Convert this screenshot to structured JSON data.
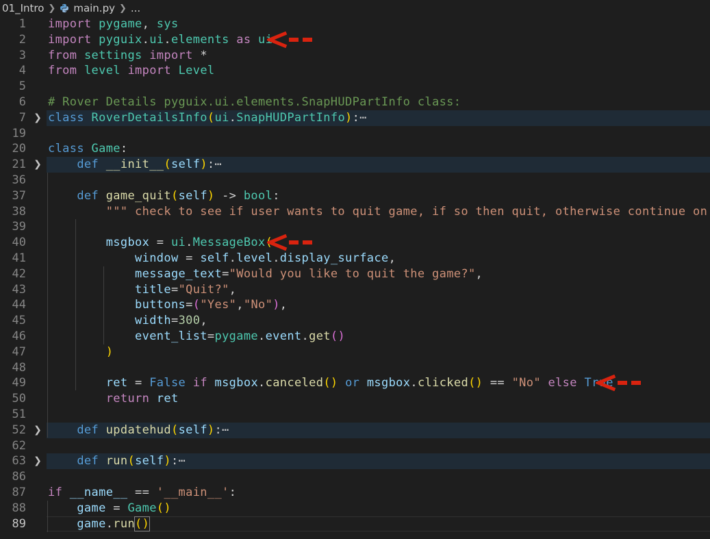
{
  "breadcrumb": {
    "folder": "01_Intro",
    "file": "main.py",
    "more": "..."
  },
  "icons": {
    "separator": "chevron-right-icon",
    "file": "python-file-icon",
    "fold": "chevron-right-icon",
    "annotation": "red-arrow-icon"
  },
  "colors": {
    "background": "#1e1e1e",
    "folded_line": "#1f2b36",
    "arrow": "#d9230f"
  },
  "editor": {
    "lines": [
      {
        "n": "1"
      },
      {
        "n": "2"
      },
      {
        "n": "3"
      },
      {
        "n": "4"
      },
      {
        "n": "5"
      },
      {
        "n": "6"
      },
      {
        "n": "7"
      },
      {
        "n": "19"
      },
      {
        "n": "20"
      },
      {
        "n": "21"
      },
      {
        "n": "36"
      },
      {
        "n": "37"
      },
      {
        "n": "38"
      },
      {
        "n": "39"
      },
      {
        "n": "40"
      },
      {
        "n": "41"
      },
      {
        "n": "42"
      },
      {
        "n": "43"
      },
      {
        "n": "44"
      },
      {
        "n": "45"
      },
      {
        "n": "46"
      },
      {
        "n": "47"
      },
      {
        "n": "48"
      },
      {
        "n": "49"
      },
      {
        "n": "50"
      },
      {
        "n": "51"
      },
      {
        "n": "52"
      },
      {
        "n": "62"
      },
      {
        "n": "63"
      },
      {
        "n": "86"
      },
      {
        "n": "87"
      },
      {
        "n": "88"
      },
      {
        "n": "89"
      }
    ],
    "tokens": {
      "l1": [
        [
          "kw",
          "import"
        ],
        [
          "op",
          " "
        ],
        [
          "cls",
          "pygame"
        ],
        [
          "op",
          ", "
        ],
        [
          "cls",
          "sys"
        ]
      ],
      "l2": [
        [
          "kw",
          "import"
        ],
        [
          "op",
          " "
        ],
        [
          "cls",
          "pyguix"
        ],
        [
          "op",
          "."
        ],
        [
          "cls",
          "ui"
        ],
        [
          "op",
          "."
        ],
        [
          "cls",
          "elements"
        ],
        [
          "op",
          " "
        ],
        [
          "kw",
          "as"
        ],
        [
          "op",
          " "
        ],
        [
          "cls",
          "ui"
        ]
      ],
      "l3": [
        [
          "kw",
          "from"
        ],
        [
          "op",
          " "
        ],
        [
          "cls",
          "settings"
        ],
        [
          "op",
          " "
        ],
        [
          "kw",
          "import"
        ],
        [
          "op",
          " *"
        ]
      ],
      "l4": [
        [
          "kw",
          "from"
        ],
        [
          "op",
          " "
        ],
        [
          "cls",
          "level"
        ],
        [
          "op",
          " "
        ],
        [
          "kw",
          "import"
        ],
        [
          "op",
          " "
        ],
        [
          "cls",
          "Level"
        ]
      ],
      "l5": [],
      "l6": [
        [
          "com",
          "# Rover Details pyguix.ui.elements.SnapHUDPartInfo class:"
        ]
      ],
      "l7": [
        [
          "kb",
          "class"
        ],
        [
          "op",
          " "
        ],
        [
          "cls",
          "RoverDetailsInfo"
        ],
        [
          "p1",
          "("
        ],
        [
          "cls",
          "ui"
        ],
        [
          "op",
          "."
        ],
        [
          "cls",
          "SnapHUDPartInfo"
        ],
        [
          "p1",
          ")"
        ],
        [
          "op",
          ":"
        ],
        [
          "dots",
          "⋯"
        ]
      ],
      "l19": [],
      "l20": [
        [
          "kb",
          "class"
        ],
        [
          "op",
          " "
        ],
        [
          "cls",
          "Game"
        ],
        [
          "op",
          ":"
        ]
      ],
      "l21": [
        [
          "op",
          "    "
        ],
        [
          "kb",
          "def"
        ],
        [
          "op",
          " "
        ],
        [
          "fn",
          "__init__"
        ],
        [
          "p1",
          "("
        ],
        [
          "var",
          "self"
        ],
        [
          "p1",
          ")"
        ],
        [
          "op",
          ":"
        ],
        [
          "dots",
          "⋯"
        ]
      ],
      "l36": [],
      "l37": [
        [
          "op",
          "    "
        ],
        [
          "kb",
          "def"
        ],
        [
          "op",
          " "
        ],
        [
          "fn",
          "game_quit"
        ],
        [
          "p1",
          "("
        ],
        [
          "var",
          "self"
        ],
        [
          "p1",
          ")"
        ],
        [
          "op",
          " -> "
        ],
        [
          "cls",
          "bool"
        ],
        [
          "op",
          ":"
        ]
      ],
      "l38": [
        [
          "op",
          "        "
        ],
        [
          "str",
          "\"\"\" check to see if user wants to quit game, if so then quit, otherwise continue on \"\"\""
        ]
      ],
      "l39": [],
      "l40": [
        [
          "op",
          "        "
        ],
        [
          "var",
          "msgbox"
        ],
        [
          "op",
          " = "
        ],
        [
          "cls",
          "ui"
        ],
        [
          "op",
          "."
        ],
        [
          "cls",
          "MessageBox"
        ],
        [
          "p1",
          "("
        ]
      ],
      "l41": [
        [
          "op",
          "            "
        ],
        [
          "var",
          "window"
        ],
        [
          "op",
          " = "
        ],
        [
          "var",
          "self"
        ],
        [
          "op",
          "."
        ],
        [
          "var",
          "level"
        ],
        [
          "op",
          "."
        ],
        [
          "var",
          "display_surface"
        ],
        [
          "op",
          ","
        ]
      ],
      "l42": [
        [
          "op",
          "            "
        ],
        [
          "var",
          "message_text"
        ],
        [
          "op",
          "="
        ],
        [
          "str",
          "\"Would you like to quit the game?\""
        ],
        [
          "op",
          ","
        ]
      ],
      "l43": [
        [
          "op",
          "            "
        ],
        [
          "var",
          "title"
        ],
        [
          "op",
          "="
        ],
        [
          "str",
          "\"Quit?\""
        ],
        [
          "op",
          ","
        ]
      ],
      "l44": [
        [
          "op",
          "            "
        ],
        [
          "var",
          "buttons"
        ],
        [
          "op",
          "="
        ],
        [
          "p2",
          "("
        ],
        [
          "str",
          "\"Yes\""
        ],
        [
          "op",
          ","
        ],
        [
          "str",
          "\"No\""
        ],
        [
          "p2",
          ")"
        ],
        [
          "op",
          ","
        ]
      ],
      "l45": [
        [
          "op",
          "            "
        ],
        [
          "var",
          "width"
        ],
        [
          "op",
          "="
        ],
        [
          "num",
          "300"
        ],
        [
          "op",
          ","
        ]
      ],
      "l46": [
        [
          "op",
          "            "
        ],
        [
          "var",
          "event_list"
        ],
        [
          "op",
          "="
        ],
        [
          "cls",
          "pygame"
        ],
        [
          "op",
          "."
        ],
        [
          "var",
          "event"
        ],
        [
          "op",
          "."
        ],
        [
          "fn",
          "get"
        ],
        [
          "p2",
          "()"
        ]
      ],
      "l47": [
        [
          "op",
          "        "
        ],
        [
          "p1",
          ")"
        ]
      ],
      "l48": [],
      "l49": [
        [
          "op",
          "        "
        ],
        [
          "var",
          "ret"
        ],
        [
          "op",
          " = "
        ],
        [
          "kb",
          "False"
        ],
        [
          "op",
          " "
        ],
        [
          "kw",
          "if"
        ],
        [
          "op",
          " "
        ],
        [
          "var",
          "msgbox"
        ],
        [
          "op",
          "."
        ],
        [
          "fn",
          "canceled"
        ],
        [
          "p1",
          "()"
        ],
        [
          "op",
          " "
        ],
        [
          "kb",
          "or"
        ],
        [
          "op",
          " "
        ],
        [
          "var",
          "msgbox"
        ],
        [
          "op",
          "."
        ],
        [
          "fn",
          "clicked"
        ],
        [
          "p1",
          "()"
        ],
        [
          "op",
          " == "
        ],
        [
          "str",
          "\"No\""
        ],
        [
          "op",
          " "
        ],
        [
          "kw",
          "else"
        ],
        [
          "op",
          " "
        ],
        [
          "kb",
          "True"
        ]
      ],
      "l50": [
        [
          "op",
          "        "
        ],
        [
          "kw",
          "return"
        ],
        [
          "op",
          " "
        ],
        [
          "var",
          "ret"
        ]
      ],
      "l51": [],
      "l52": [
        [
          "op",
          "    "
        ],
        [
          "kb",
          "def"
        ],
        [
          "op",
          " "
        ],
        [
          "fn",
          "updatehud"
        ],
        [
          "p1",
          "("
        ],
        [
          "var",
          "self"
        ],
        [
          "p1",
          ")"
        ],
        [
          "op",
          ":"
        ],
        [
          "dots",
          "⋯"
        ]
      ],
      "l62": [],
      "l63": [
        [
          "op",
          "    "
        ],
        [
          "kb",
          "def"
        ],
        [
          "op",
          " "
        ],
        [
          "fn",
          "run"
        ],
        [
          "p1",
          "("
        ],
        [
          "var",
          "self"
        ],
        [
          "p1",
          ")"
        ],
        [
          "op",
          ":"
        ],
        [
          "dots",
          "⋯"
        ]
      ],
      "l86": [],
      "l87": [
        [
          "kw",
          "if"
        ],
        [
          "op",
          " "
        ],
        [
          "var",
          "__name__"
        ],
        [
          "op",
          " == "
        ],
        [
          "str",
          "'__main__'"
        ],
        [
          "op",
          ":"
        ]
      ],
      "l88": [
        [
          "op",
          "    "
        ],
        [
          "var",
          "game"
        ],
        [
          "op",
          " = "
        ],
        [
          "cls",
          "Game"
        ],
        [
          "p1",
          "()"
        ]
      ],
      "l89": [
        [
          "op",
          "    "
        ],
        [
          "var",
          "game"
        ],
        [
          "op",
          "."
        ],
        [
          "fn",
          "run"
        ],
        [
          "p1",
          "()"
        ]
      ]
    }
  }
}
